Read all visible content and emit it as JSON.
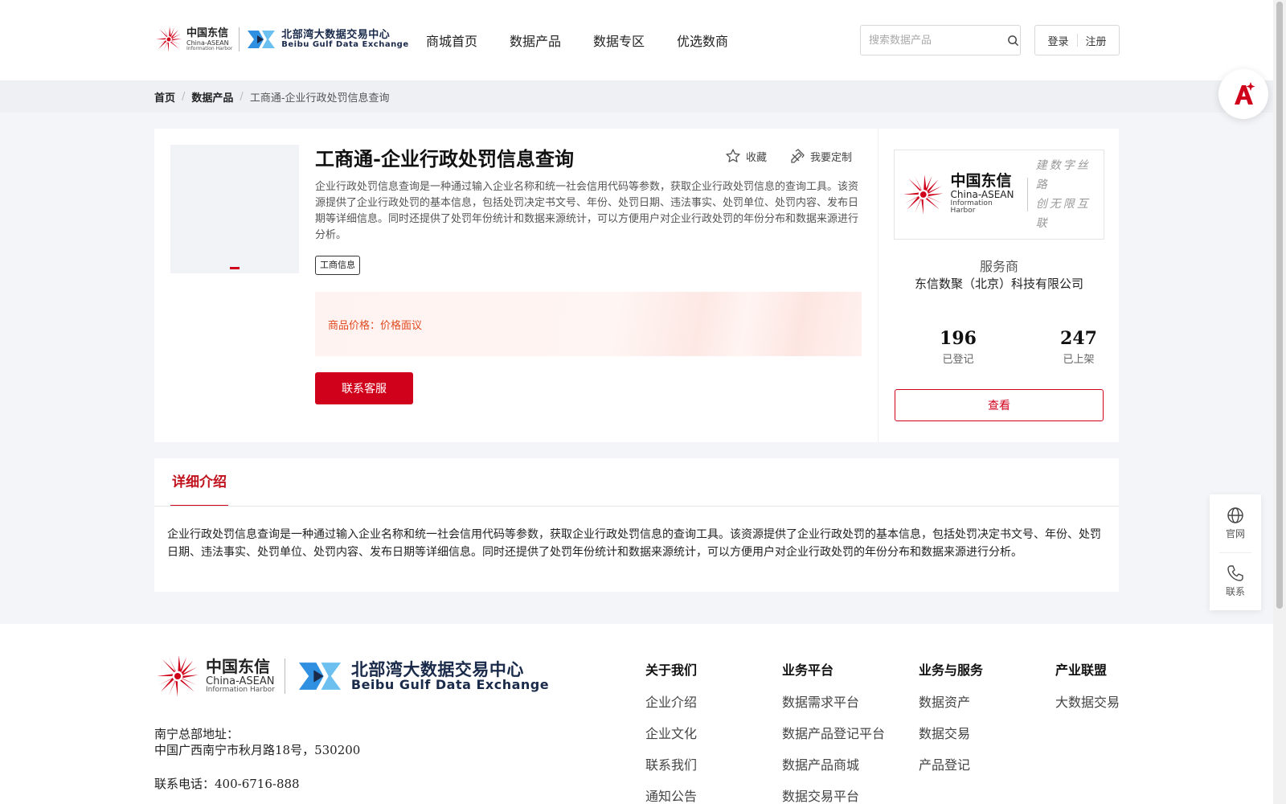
{
  "header": {
    "logo_cn_l1": "中国东信",
    "logo_cn_l2": "China-ASEAN",
    "logo_cn_l3": "Information Harbor",
    "logo_bx_l1": "北部湾大数据交易中心",
    "logo_bx_l2": "Beibu Gulf Data Exchange",
    "nav": [
      "商城首页",
      "数据产品",
      "数据专区",
      "优选数商"
    ],
    "search_placeholder": "搜索数据产品",
    "login": "登录",
    "register": "注册"
  },
  "breadcrumb": {
    "home": "首页",
    "category": "数据产品",
    "current": "工商通-企业行政处罚信息查询",
    "sep": "/"
  },
  "product": {
    "title": "工商通-企业行政处罚信息查询",
    "favorite": "收藏",
    "customize": "我要定制",
    "description": "企业行政处罚信息查询是一种通过输入企业名称和统一社会信用代码等参数，获取企业行政处罚信息的查询工具。该资源提供了企业行政处罚的基本信息，包括处罚决定书文号、年份、处罚日期、违法事实、处罚单位、处罚内容、发布日期等详细信息。同时还提供了处罚年份统计和数据来源统计，可以方便用户对企业行政处罚的年份分布和数据来源进行分析。",
    "tag": "工商信息",
    "price_label": "商品价格：",
    "price_value": "价格面议",
    "contact_button": "联系客服"
  },
  "provider": {
    "logo_l1": "中国东信",
    "logo_l2": "China-ASEAN",
    "logo_l3": "Information Harbor",
    "slogan_l1": "建数字丝路",
    "slogan_l2": "创无限互联",
    "label": "服务商",
    "name": "东信数聚（北京）科技有限公司",
    "registered_count": "196",
    "registered_label": "已登记",
    "listed_count": "247",
    "listed_label": "已上架",
    "view_button": "查看"
  },
  "detail": {
    "tab": "详细介绍",
    "text": "企业行政处罚信息查询是一种通过输入企业名称和统一社会信用代码等参数，获取企业行政处罚信息的查询工具。该资源提供了企业行政处罚的基本信息，包括处罚决定书文号、年份、处罚日期、违法事实、处罚单位、处罚内容、发布日期等详细信息。同时还提供了处罚年份统计和数据来源统计，可以方便用户对企业行政处罚的年份分布和数据来源进行分析。"
  },
  "sidefloat": {
    "website": "官网",
    "contact": "联系"
  },
  "footer": {
    "address_label": "南宁总部地址：",
    "address": "中国广西南宁市秋月路18号，530200",
    "phone": "联系电话：400-6716-888",
    "columns": [
      {
        "title": "关于我们",
        "items": [
          "企业介绍",
          "企业文化",
          "联系我们",
          "通知公告"
        ]
      },
      {
        "title": "业务平台",
        "items": [
          "数据需求平台",
          "数据产品登记平台",
          "数据产品商城",
          "数据交易平台"
        ]
      },
      {
        "title": "业务与服务",
        "items": [
          "数据资产",
          "数据交易",
          "产品登记"
        ]
      },
      {
        "title": "产业联盟",
        "items": [
          "大数据交易"
        ]
      }
    ]
  },
  "colors": {
    "brand_red": "#d0021b",
    "price_orange": "#e0491f",
    "bx_blue": "#2f8fe0"
  },
  "icons": [
    "search-icon",
    "star-icon",
    "customize-icon",
    "ai-assistant-icon",
    "globe-icon",
    "phone-icon"
  ]
}
